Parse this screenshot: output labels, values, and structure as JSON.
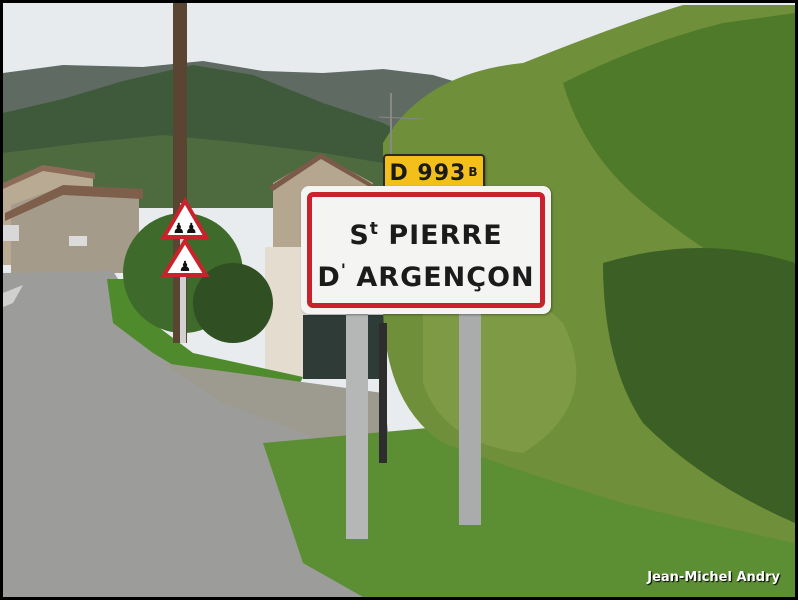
{
  "sign": {
    "line1_main": "S",
    "line1_sup": "t",
    "line1_rest": " PIERRE",
    "line2_main": "D",
    "line2_sup": "'",
    "line2_rest": " ARGENÇON"
  },
  "route": {
    "number": "D 993",
    "suffix": "B"
  },
  "credit": "Jean-Michel Andry",
  "colors": {
    "sign_border": "#c8232c",
    "route_plate": "#f3bf1a",
    "sky": "#e9ecef",
    "foliage": "#6f8f3a"
  }
}
